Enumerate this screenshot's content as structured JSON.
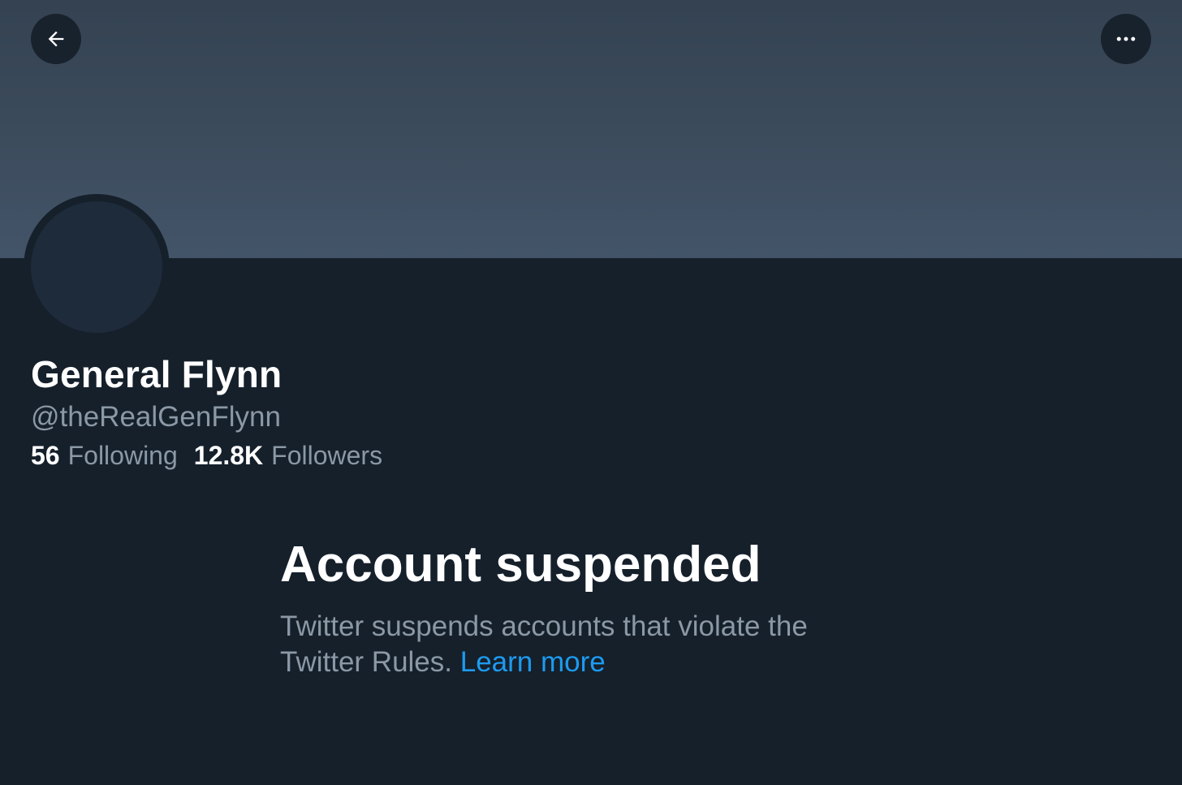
{
  "header": {
    "back_icon": "arrow-left-icon",
    "more_icon": "more-horizontal-icon"
  },
  "profile": {
    "display_name": "General Flynn",
    "handle": "@theRealGenFlynn",
    "following_count": "56",
    "following_label": "Following",
    "followers_count": "12.8K",
    "followers_label": "Followers"
  },
  "notice": {
    "title": "Account suspended",
    "message": "Twitter suspends accounts that violate the Twitter Rules.",
    "link_label": "Learn more"
  },
  "colors": {
    "background": "#15202b",
    "banner": "#3b4a5a",
    "link": "#1d9bf0",
    "secondary_text": "#8b98a5"
  }
}
